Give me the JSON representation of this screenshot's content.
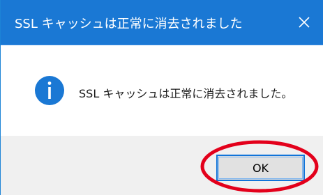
{
  "window": {
    "title": "SSL キャッシュは正常に消去されました"
  },
  "dialog": {
    "message": "SSL キャッシュは正常に消去されました。",
    "icon": "info-icon",
    "ok_label": "OK"
  },
  "colors": {
    "titlebar": "#1a78d4",
    "icon": "#1a78d4",
    "footer": "#f0f0f0",
    "button_border": "#1174d9",
    "highlight": "#e3001b"
  }
}
